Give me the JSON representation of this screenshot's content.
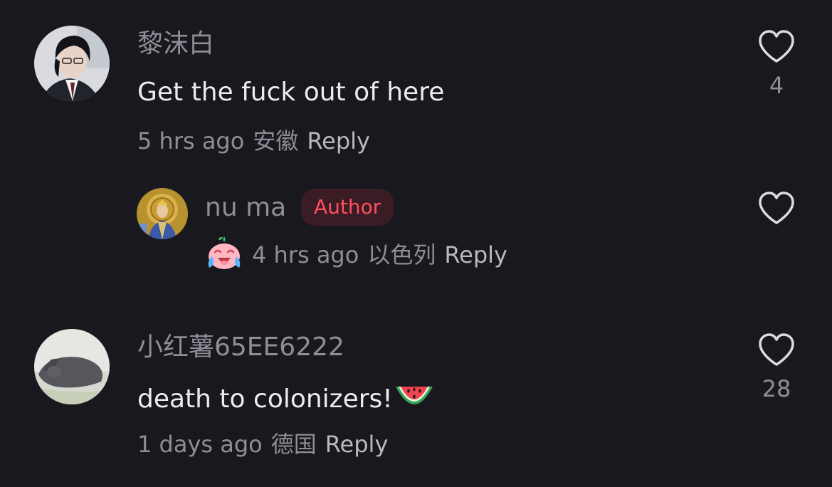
{
  "comments": [
    {
      "username": "黎沫白",
      "text": "Get the fuck out of here",
      "time": "5 hrs ago",
      "location": "安徽",
      "reply_label": "Reply",
      "likes": "4",
      "replies": [
        {
          "username": "nu ma",
          "badge": "Author",
          "emoji": "crying-laughing-face-emoji",
          "time": "4 hrs ago",
          "location": "以色列",
          "reply_label": "Reply"
        }
      ]
    },
    {
      "username": "小红薯65EE6222",
      "text": "death to colonizers!",
      "emoji": "watermelon-emoji",
      "time": "1 days ago",
      "location": "德国",
      "reply_label": "Reply",
      "likes": "28"
    }
  ],
  "colors": {
    "background": "#19181e",
    "author_badge_bg": "#3a1d24",
    "author_badge_text": "#ff4f61",
    "muted_text": "#8f8e96",
    "primary_text": "#ecebf0"
  }
}
